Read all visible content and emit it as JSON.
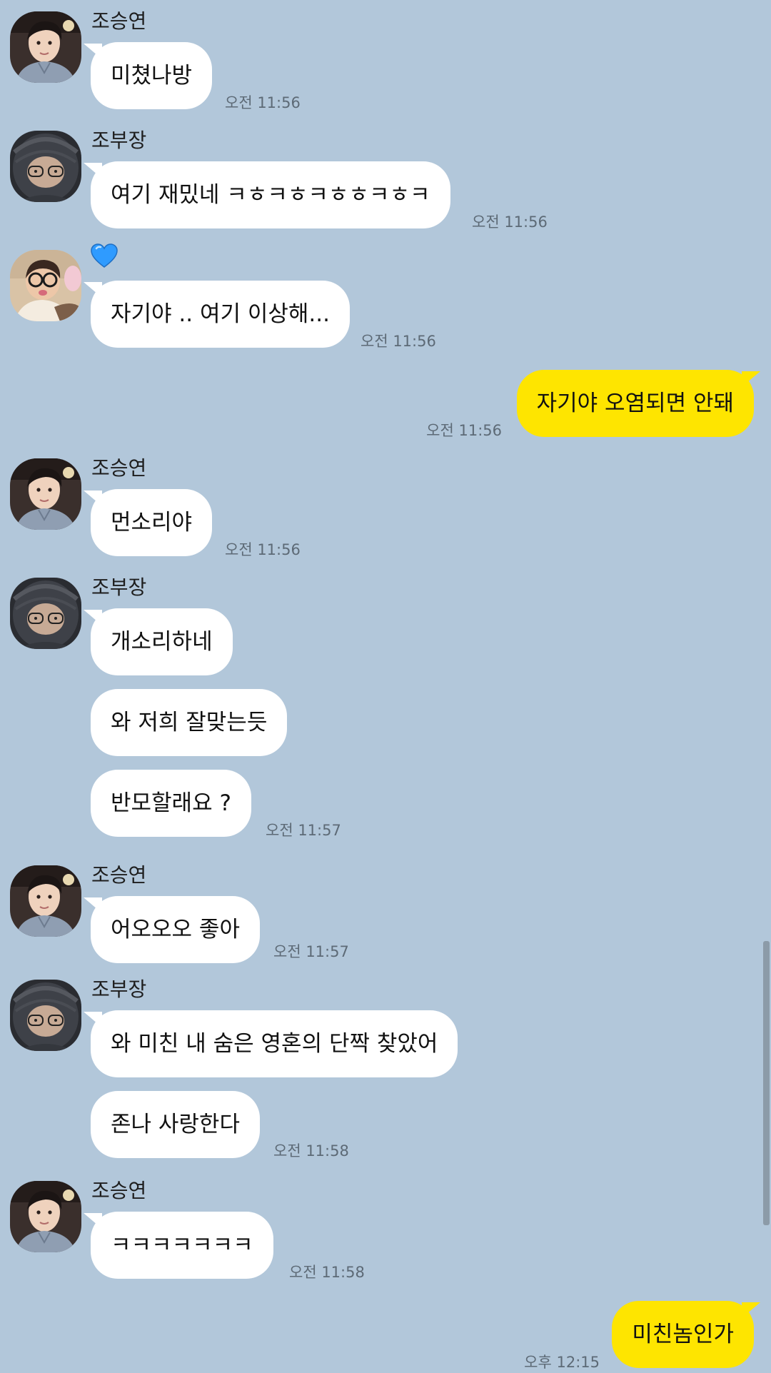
{
  "users": {
    "seungyeon": {
      "name": "조승연"
    },
    "bujang": {
      "name": "조부장"
    },
    "heart": {
      "name": "💙"
    }
  },
  "messages": [
    {
      "text": "미쳤나방",
      "time": "오전 11:56"
    },
    {
      "text": "여기 재밌네 ㅋㅎㅋㅎㅋㅎㅎㅋㅎㅋ",
      "time": "오전 11:56"
    },
    {
      "text": "자기야 .. 여기 이상해...",
      "time": "오전 11:56"
    },
    {
      "text": "자기야 오염되면 안돼",
      "time": "오전 11:56"
    },
    {
      "text": "먼소리야",
      "time": "오전 11:56"
    },
    {
      "text": "개소리하네"
    },
    {
      "text": "와 저희 잘맞는듯"
    },
    {
      "text": "반모할래요 ?",
      "time": "오전 11:57"
    },
    {
      "text": "어오오오 좋아",
      "time": "오전 11:57"
    },
    {
      "text": "와 미친 내 숨은 영혼의 단짝 찾았어"
    },
    {
      "text": "존나 사랑한다",
      "time": "오전 11:58"
    },
    {
      "text": "ㅋㅋㅋㅋㅋㅋㅋ",
      "time": "오전 11:58"
    },
    {
      "text": "미친놈인가",
      "time": "오후 12:15"
    }
  ],
  "colors": {
    "background": "#b2c7da",
    "incoming_bubble": "#ffffff",
    "outgoing_bubble": "#fee500",
    "timestamp": "#5d6a76",
    "heart": "#2f9bff"
  }
}
